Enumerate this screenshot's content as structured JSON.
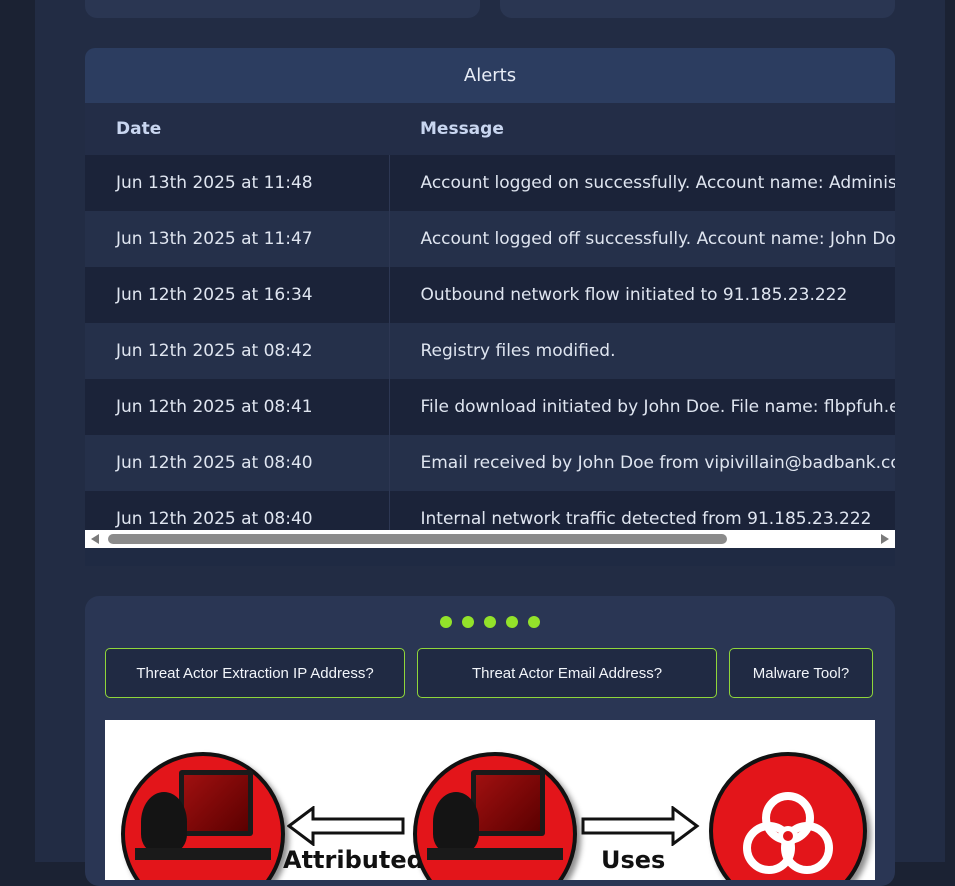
{
  "alerts": {
    "title": "Alerts",
    "columns": {
      "date": "Date",
      "message": "Message"
    },
    "rows": [
      {
        "date": "Jun 13th 2025 at 11:48",
        "message": "Account logged on successfully. Account name: Administrator"
      },
      {
        "date": "Jun 13th 2025 at 11:47",
        "message": "Account logged off successfully. Account name: John Doe"
      },
      {
        "date": "Jun 12th 2025 at 16:34",
        "message": "Outbound network flow initiated to 91.185.23.222"
      },
      {
        "date": "Jun 12th 2025 at 08:42",
        "message": "Registry files modified."
      },
      {
        "date": "Jun 12th 2025 at 08:41",
        "message": "File download initiated by John Doe. File name: flbpfuh.exe"
      },
      {
        "date": "Jun 12th 2025 at 08:40",
        "message": "Email received by John Doe from vipivillain@badbank.com"
      },
      {
        "date": "Jun 12th 2025 at 08:40",
        "message": "Internal network traffic detected from 91.185.23.222"
      }
    ]
  },
  "questions": {
    "progress_dots": 5,
    "buttons": [
      "Threat Actor Extraction IP Address?",
      "Threat Actor Email Address?",
      "Malware Tool?"
    ]
  },
  "diagram": {
    "labels": {
      "attributed": "Attributed",
      "uses": "Uses"
    }
  },
  "colors": {
    "accent_green": "#93e22a",
    "diagram_red": "#e3151a",
    "header_blue": "#2c3d60"
  }
}
